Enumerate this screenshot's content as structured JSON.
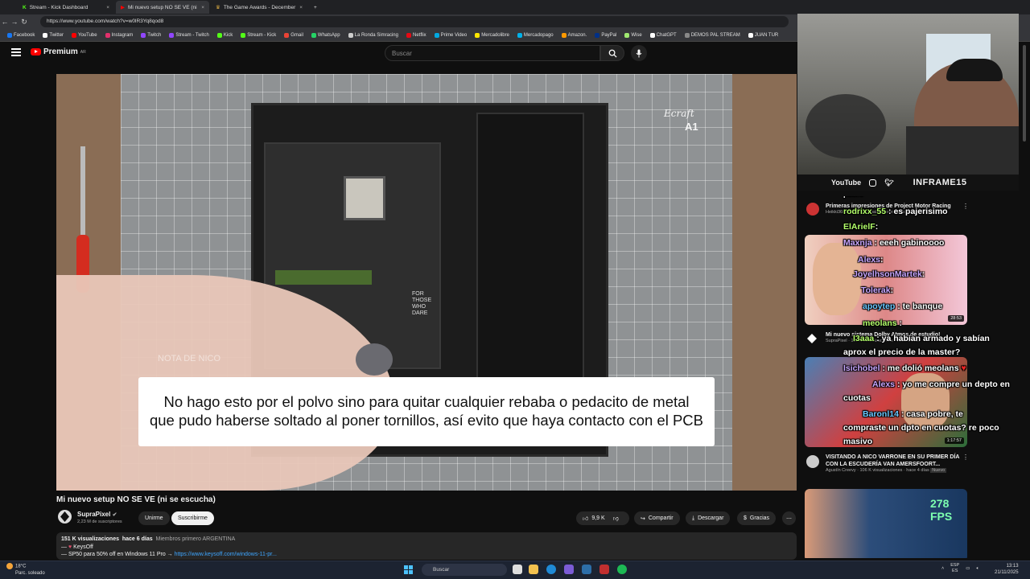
{
  "browser": {
    "tabs": [
      {
        "label": "Stream - Kick Dashboard",
        "icon": "kick-icon"
      },
      {
        "label": "Mi nuevo setup NO SE VE (ni se e",
        "icon": "youtube-icon"
      },
      {
        "label": "The Game Awards - December 1",
        "icon": "tga-icon"
      }
    ],
    "url": "https://www.youtube.com/watch?v=w0lR3Yq8qod8",
    "bookmarks": [
      {
        "label": "Facebook",
        "color": "#1877f2"
      },
      {
        "label": "Twitter",
        "color": "#ffffff"
      },
      {
        "label": "YouTube",
        "color": "#ff0000"
      },
      {
        "label": "Instagram",
        "color": "#e1306c"
      },
      {
        "label": "Twitch",
        "color": "#9146ff"
      },
      {
        "label": "Stream - Twitch",
        "color": "#9146ff"
      },
      {
        "label": "Kick",
        "color": "#53fc18"
      },
      {
        "label": "Stream - Kick",
        "color": "#53fc18"
      },
      {
        "label": "Gmail",
        "color": "#ea4335"
      },
      {
        "label": "WhatsApp",
        "color": "#25d366"
      },
      {
        "label": "La Ronda Simracing",
        "color": "#cccccc"
      },
      {
        "label": "Netflix",
        "color": "#e50914"
      },
      {
        "label": "Prime Video",
        "color": "#00a8e1"
      },
      {
        "label": "Mercadolibre",
        "color": "#ffe600"
      },
      {
        "label": "Mercadopago",
        "color": "#00b1ea"
      },
      {
        "label": "Amazon.",
        "color": "#ff9900"
      },
      {
        "label": "PayPal",
        "color": "#003087"
      },
      {
        "label": "Wise",
        "color": "#9fe870"
      },
      {
        "label": "ChatGPT",
        "color": "#ffffff"
      },
      {
        "label": "DEMOS PAL STREAM",
        "color": "#888888"
      },
      {
        "label": "JUAN TUR",
        "color": "#ffffff"
      }
    ]
  },
  "youtube": {
    "logo_text": "Premium",
    "logo_sup": "AR",
    "search_placeholder": "Buscar",
    "video": {
      "subtitle_line1": "No hago esto por el polvo sino para quitar cualquier rebaba o pedacito de metal",
      "subtitle_line2": "que pudo haberse soltado al poner tornillos, así evito que haya contacto con el PCB",
      "watermark": "NOTA DE NICO",
      "mat_brand": "Ecraft",
      "mat_size": "A1",
      "case_text": "FOR THOSE WHO DARE"
    },
    "title": "Mi nuevo setup NO SE VE (ni se escucha)",
    "channel": {
      "name": "SupraPixel",
      "subs": "2,23 M de suscriptores",
      "join_label": "Unirme",
      "subscribe_label": "Suscribirme"
    },
    "actions": {
      "likes": "9,9 K",
      "share": "Compartir",
      "download": "Descargar",
      "thanks": "Gracias"
    },
    "description": {
      "views": "151 K visualizaciones",
      "age": "hace 6 días",
      "tags": "Miembros primero  ARGENTINA",
      "line2": "KeysOff",
      "line3_text": "SP50 para 50% off en Windows 11 Pro →",
      "line3_link": "https://www.keysoff.com/windows-11-pr..."
    },
    "recommendations": [
      {
        "title": "Primeras impresiones de Project Motor Racing",
        "channel": "Heikki360ES",
        "meta": "14 K visualizaciones · hace 5 horas",
        "badge": "Nuevo"
      },
      {
        "title": "Mi nuevo sistema Dolby Atmos de estudio!",
        "channel": "SupraPixel",
        "meta": "111 K visualizaciones · hace 1 mes",
        "duration": "28:53"
      },
      {
        "title": "",
        "channel": "",
        "meta": "",
        "duration": "1:17:57"
      },
      {
        "title": "VISITANDO A NICO VARRONE EN SU PRIMER DÍA CON LA ESCUDERÍA VAN AMERSFOORT...",
        "channel": "Agustín Creevy",
        "meta": "106 K visualizaciones · hace 4 días",
        "badge": "Nuevo"
      },
      {
        "title": "",
        "channel": "",
        "meta": "",
        "thumb_text": "278 FPS"
      }
    ]
  },
  "overlay": {
    "social_youtube": "YouTube",
    "brand": "INFRAME15",
    "chat": [
      {
        "user": "",
        "msg": "pobre"
      },
      {
        "user": "rodrixx_55",
        "msg": ": es pajerisimo"
      },
      {
        "user": "ElArielF",
        "msg": ":"
      },
      {
        "user": "Maxnja",
        "msg": ": eeeh gabinoooo"
      },
      {
        "user": "Alexs",
        "msg": ":"
      },
      {
        "user": "JoyelhsonMartek",
        "msg": ":"
      },
      {
        "user": "Tolerak",
        "msg": ":"
      },
      {
        "user": "apoytep",
        "msg": ": te banque"
      },
      {
        "user": "meolans",
        "msg": ":"
      },
      {
        "user": "I3aaa",
        "msg": ": ya habían armado y sabían"
      },
      {
        "user": "",
        "msg": "aprox el precio de la master?"
      },
      {
        "user": "Isichobel",
        "msg": ": me dolió meolans"
      },
      {
        "user": "Alexs",
        "msg": ": yo me compre un depto en"
      },
      {
        "user": "",
        "msg": "cuotas"
      },
      {
        "user": "Baronl14",
        "msg": ": casa pobre, te"
      },
      {
        "user": "",
        "msg": "compraste un dpto en cuotas? re poco"
      },
      {
        "user": "",
        "msg": "masivo"
      }
    ]
  },
  "taskbar": {
    "weather_temp": "18°C",
    "weather_desc": "Parc. soleado",
    "search": "Buscar",
    "lang": "ESP",
    "lang2": "ES",
    "time": "13:13",
    "date": "21/11/2025"
  }
}
